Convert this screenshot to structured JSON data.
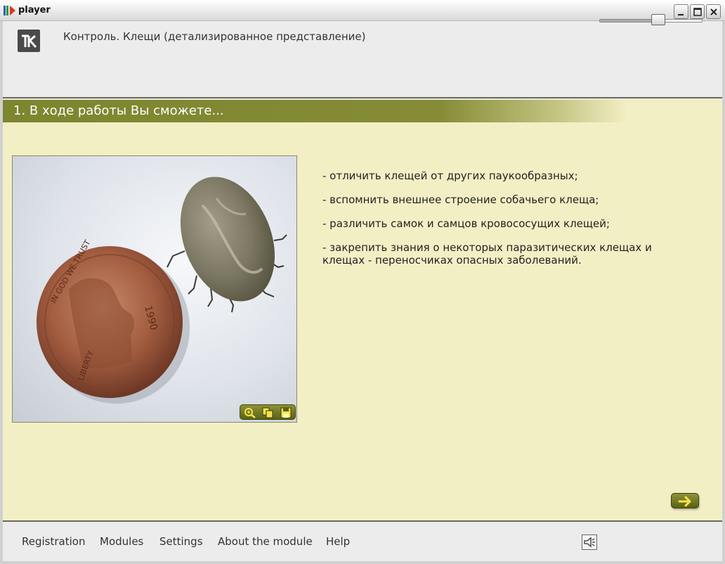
{
  "window": {
    "title": "player",
    "minimize_icon": "minimize-icon",
    "maximize_icon": "maximize-icon",
    "close_icon": "close-icon"
  },
  "header": {
    "logo_icon": "brand-logo-icon",
    "title": "Контроль. Клещи (детализированное представление)"
  },
  "section": {
    "title": "1. В ходе работы Вы сможете..."
  },
  "photo": {
    "toolbar": [
      {
        "icon": "zoom-icon"
      },
      {
        "icon": "copy-icon"
      },
      {
        "icon": "save-icon"
      }
    ]
  },
  "bullets": [
    "- отличить клещей от других паукообразных;",
    "- вспомнить внешнее строение собачьего клеща;",
    "- различить самок и самцов кровососущих клещей;",
    "- закрепить знания о некоторых паразитических клещах и клещах - переносчиках опасных заболеваний."
  ],
  "navigation": {
    "next_icon": "arrow-right-icon"
  },
  "footer": {
    "menu": [
      "Registration",
      "Modules",
      "Settings",
      "About the module",
      "Help"
    ],
    "volume_icon": "speaker-icon",
    "volume_level": 0.5
  },
  "colors": {
    "accent": "#7d852f",
    "content_bg": "#f3efc5"
  }
}
